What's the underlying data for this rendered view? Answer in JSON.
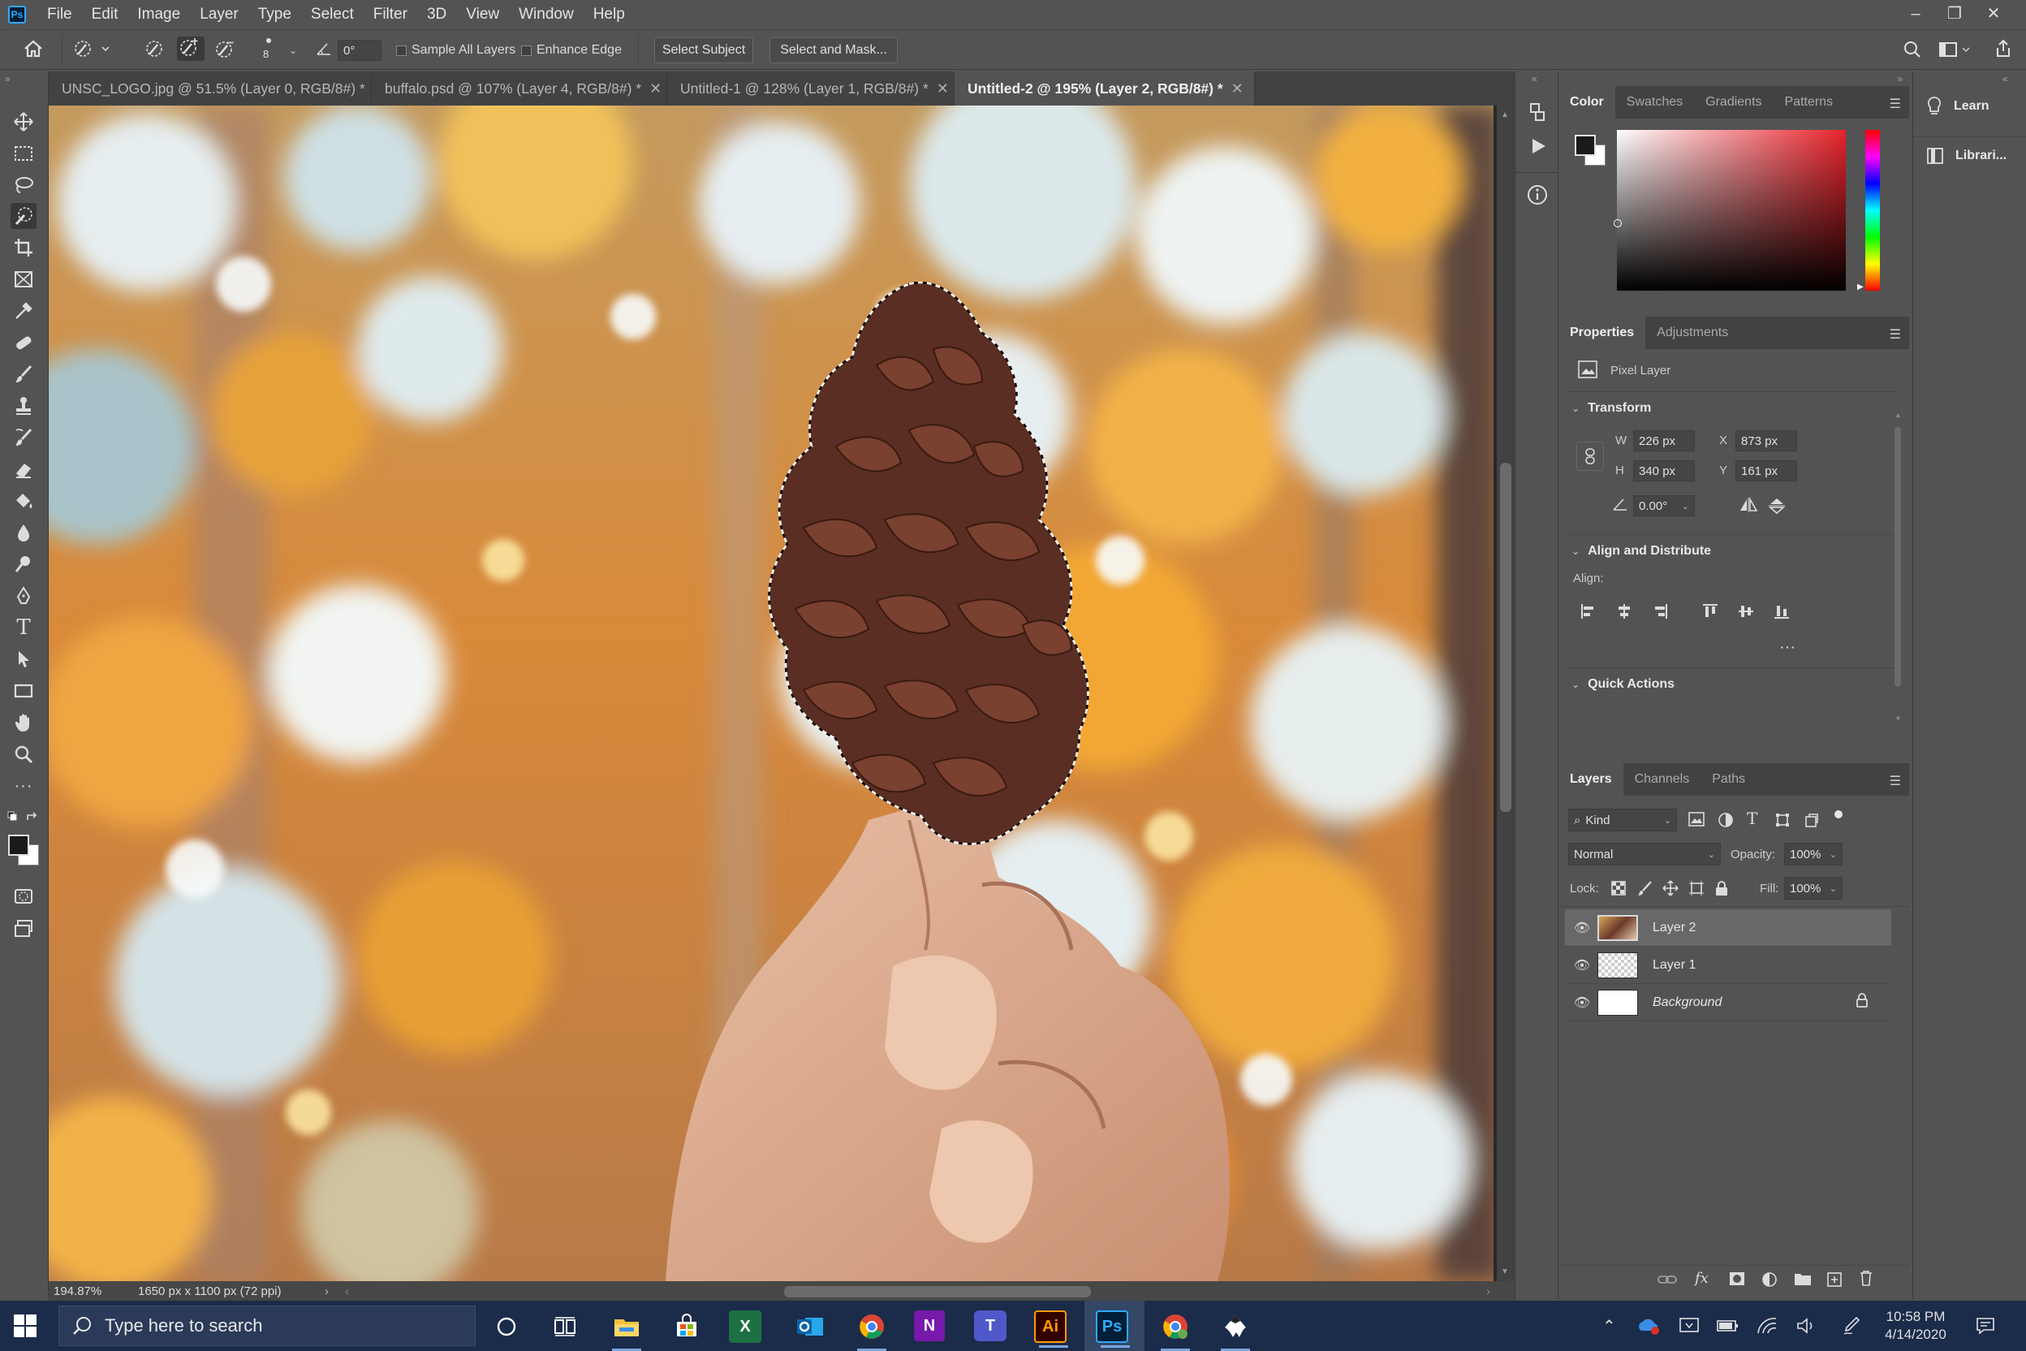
{
  "menubar": {
    "app_icon": "photoshop-logo",
    "items": [
      "File",
      "Edit",
      "Image",
      "Layer",
      "Type",
      "Select",
      "Filter",
      "3D",
      "View",
      "Window",
      "Help"
    ],
    "window_controls": [
      "minimize-icon",
      "restore-icon",
      "close-icon"
    ]
  },
  "options": {
    "brush_size": "8",
    "angle": "0°",
    "sample_all_layers": "Sample All Layers",
    "enhance_edge": "Enhance Edge",
    "select_subject": "Select Subject",
    "select_and_mask": "Select and Mask..."
  },
  "tabs": [
    {
      "label": "UNSC_LOGO.jpg @ 51.5% (Layer 0, RGB/8#) *",
      "active": false
    },
    {
      "label": "buffalo.psd @ 107% (Layer 4, RGB/8#) *",
      "active": false
    },
    {
      "label": "Untitled-1 @ 128% (Layer 1, RGB/8#) *",
      "active": false
    },
    {
      "label": "Untitled-2 @ 195% (Layer 2, RGB/8#) *",
      "active": true
    }
  ],
  "status": {
    "zoom": "194.87%",
    "doc_info": "1650 px x 1100 px (72 ppi)"
  },
  "color_panel": {
    "tabs": [
      "Color",
      "Swatches",
      "Gradients",
      "Patterns"
    ],
    "hue_color": "#e8232b"
  },
  "properties": {
    "tabs": [
      "Properties",
      "Adjustments"
    ],
    "layer_type": "Pixel Layer",
    "transform_title": "Transform",
    "w_label": "W",
    "w": "226 px",
    "h_label": "H",
    "h": "340 px",
    "x_label": "X",
    "x": "873 px",
    "y_label": "Y",
    "y": "161 px",
    "angle": "0.00°",
    "align_title": "Align and Distribute",
    "align_label": "Align:",
    "quick_actions": "Quick Actions"
  },
  "layers_panel": {
    "tabs": [
      "Layers",
      "Channels",
      "Paths"
    ],
    "filter_kind": "Kind",
    "blend_mode": "Normal",
    "opacity_label": "Opacity:",
    "opacity": "100%",
    "lock_label": "Lock:",
    "fill_label": "Fill:",
    "fill": "100%",
    "layers": [
      {
        "name": "Layer 2",
        "selected": true
      },
      {
        "name": "Layer 1",
        "selected": false
      },
      {
        "name": "Background",
        "selected": false
      }
    ]
  },
  "learn_panel": {
    "learn": "Learn",
    "libraries": "Librari..."
  },
  "taskbar": {
    "search_placeholder": "Type here to search",
    "time": "10:58 PM",
    "date": "4/14/2020",
    "apps": [
      "cortana-icon",
      "task-view-icon",
      "file-explorer-icon",
      "store-icon",
      "excel-icon",
      "outlook-icon",
      "chrome-icon",
      "onenote-icon",
      "teams-icon",
      "illustrator-icon",
      "photoshop-icon",
      "chrome-profile-icon",
      "inkscape-icon"
    ],
    "ai_label": "Ai",
    "ps_label": "Ps",
    "x_label": "X",
    "n_label": "N",
    "t_label": "T"
  }
}
